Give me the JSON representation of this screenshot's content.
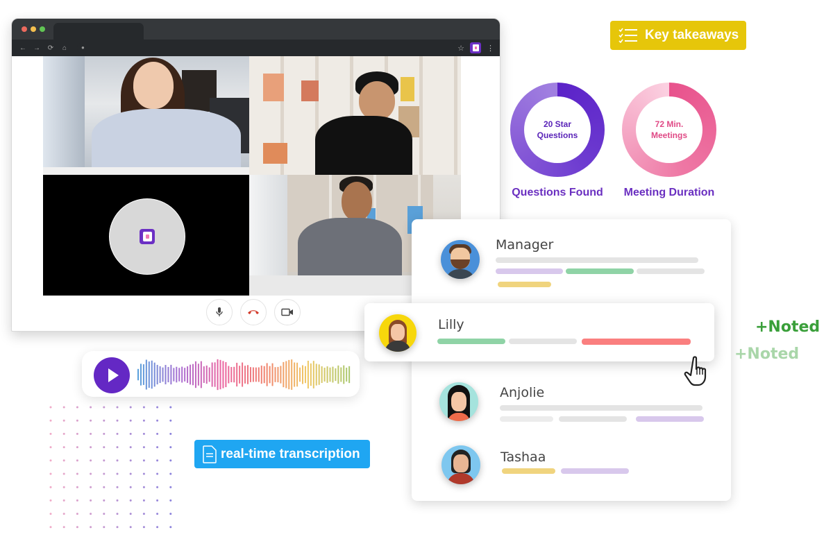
{
  "browser": {
    "traffic_lights": [
      "#ec6a5e",
      "#f4bf4f",
      "#61c554"
    ],
    "nav_icons": [
      "back-arrow",
      "forward-arrow",
      "reload",
      "home"
    ],
    "nav_glyphs": [
      "←",
      "→",
      "⟳",
      "⌂"
    ],
    "lock_glyph": "●",
    "star_glyph": "☆",
    "menu_glyph": "⋮"
  },
  "meeting": {
    "participants_tiles": [
      "participant-woman",
      "participant-man-black-shirt",
      "participant-audio-only",
      "participant-man-suit"
    ],
    "controls": [
      {
        "name": "microphone",
        "label": "mic"
      },
      {
        "name": "end-call",
        "label": "hang up"
      },
      {
        "name": "camera",
        "label": "video"
      }
    ]
  },
  "key_takeaways": {
    "label": "Key takeaways",
    "color": "#e6c60a"
  },
  "stats": [
    {
      "value_line1": "20 Star",
      "value_line2": "Questions",
      "label": "Questions Found",
      "colors": [
        "#5b22c8",
        "#9b73dc"
      ],
      "text_color": "#5a24b8"
    },
    {
      "value_line1": "72 Min.",
      "value_line2": "Meetings",
      "label": "Meeting Duration",
      "colors": [
        "#e8528c",
        "#f9c7dc"
      ],
      "text_color": "#e04a86",
      "label_color": "#6a2fc0"
    }
  ],
  "people": [
    {
      "name": "Manager",
      "avatar_bg": "#4a90d9"
    },
    {
      "name": "Lilly",
      "avatar_bg": "#f7d70c"
    },
    {
      "name": "Anjolie",
      "avatar_bg": "#a5e3dd"
    },
    {
      "name": "Tashaa",
      "avatar_bg": "#7ec7ef"
    }
  ],
  "noted": [
    {
      "label": "+Noted",
      "color": "#3a9f3a"
    },
    {
      "label": "+Noted",
      "color": "#a9d6a9"
    }
  ],
  "audio_player": {
    "play_label": "play"
  },
  "transcription": {
    "label": "real-time transcription",
    "color": "#1fa6f2"
  }
}
